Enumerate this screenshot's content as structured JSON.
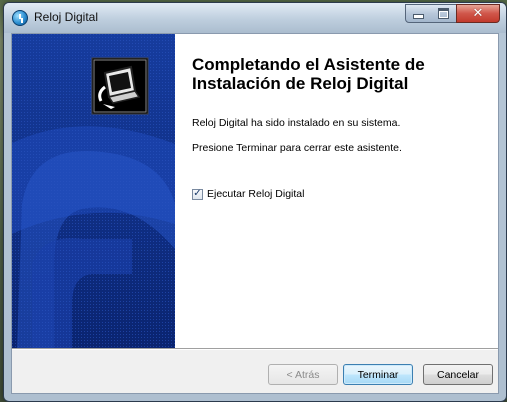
{
  "window": {
    "title": "Reloj Digital"
  },
  "wizard": {
    "heading": "Completando el Asistente de Instalación de Reloj Digital",
    "line1": "Reloj Digital ha sido instalado en su sistema.",
    "line2": "Presione Terminar para cerrar este asistente.",
    "run_checkbox": {
      "label": "Ejecutar Reloj Digital",
      "checked": true
    }
  },
  "buttons": {
    "back": "< Atrás",
    "finish": "Terminar",
    "cancel": "Cancelar"
  },
  "icons": {
    "app": "clock-app-icon",
    "installer": "installer-computer-icon",
    "minimize": "minimize-icon",
    "maximize": "maximize-icon",
    "close": "close-icon"
  },
  "colors": {
    "side_panel": "#0f2f86",
    "default_button_border": "#3c7fb1",
    "close_button": "#c23a2c"
  }
}
